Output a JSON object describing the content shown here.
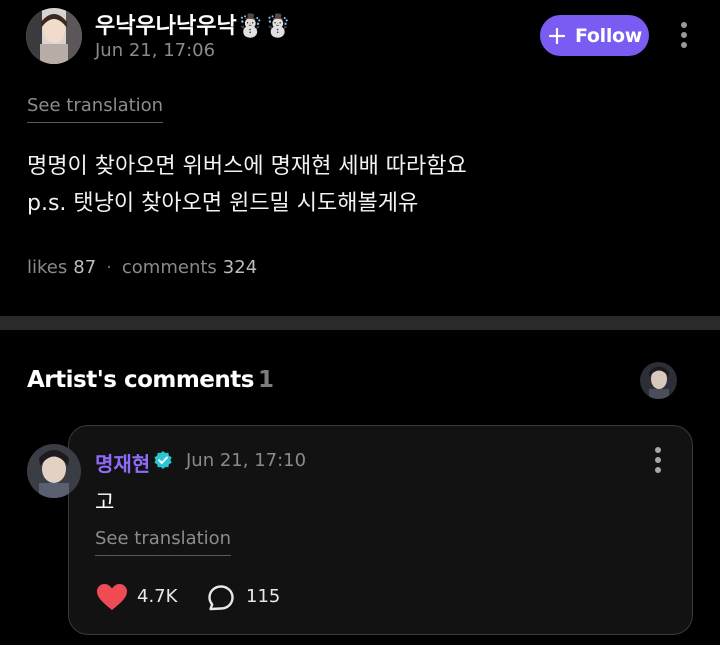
{
  "post": {
    "author": "우낙우나낙우낙☃️☃️",
    "time": "Jun 21, 17:06",
    "follow_label": "Follow",
    "see_translation": "See translation",
    "body_lines": [
      "명명이 찾아오면 위버스에 명재현 세배 따라함요",
      "p.s. 탯냥이 찾아오면 윈드밀 시도해볼게유"
    ],
    "likes_label": "likes",
    "likes_count": "87",
    "comments_label": "comments",
    "comments_count": "324"
  },
  "artist_comments": {
    "title": "Artist's comments",
    "count": "1"
  },
  "comment": {
    "author": "명재현",
    "time": "Jun 21, 17:10",
    "text": "고",
    "see_translation": "See translation",
    "like_count": "4.7K",
    "reply_count": "115"
  },
  "colors": {
    "background": "#000000",
    "follow_button": "#7a5cf2",
    "artist_name": "#8e6cf7",
    "verified_badge": "#29c6d6",
    "like_heart": "#f04b55"
  },
  "icons": [
    "plus-icon",
    "more-vertical-icon",
    "verified-badge-icon",
    "heart-icon",
    "comment-bubble-icon"
  ]
}
